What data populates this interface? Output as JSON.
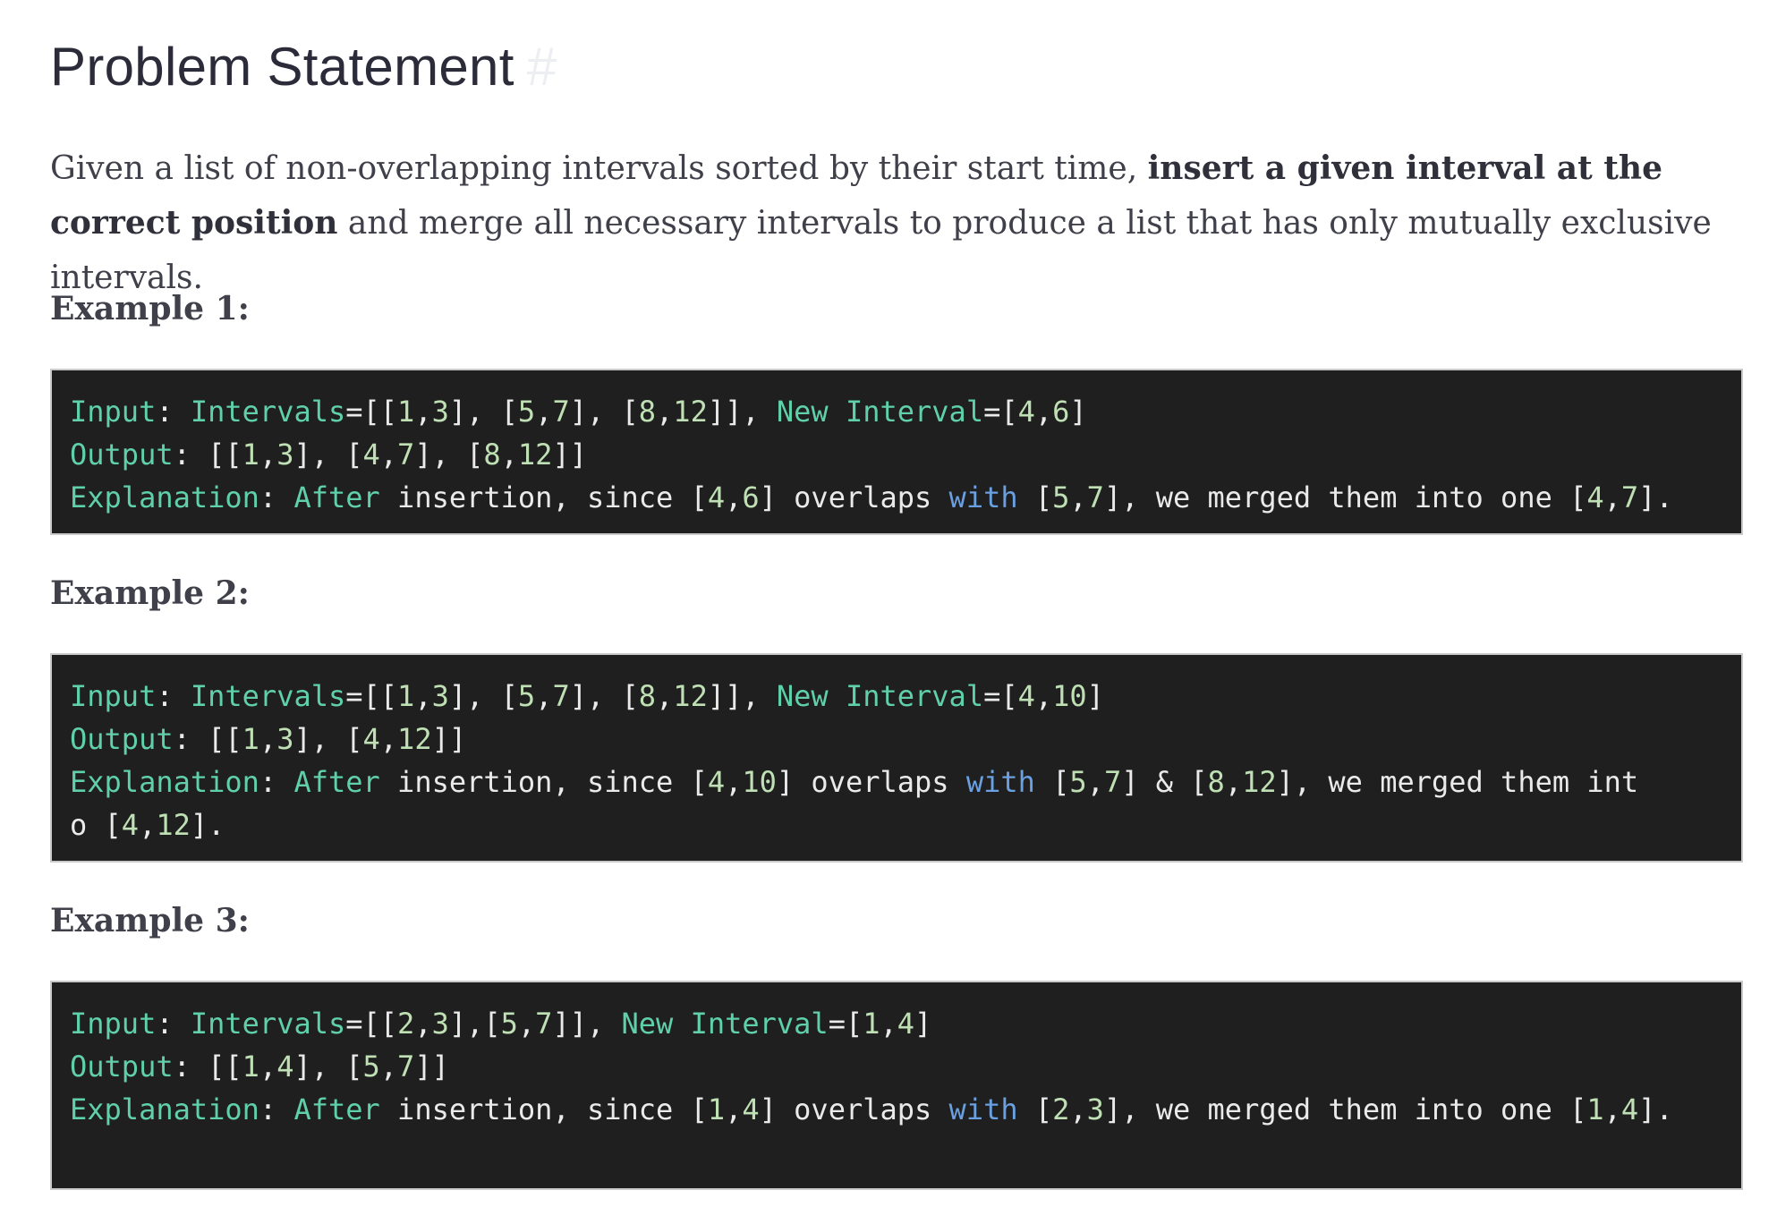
{
  "heading": {
    "title": "Problem Statement",
    "anchor": "#"
  },
  "statement": {
    "lead": "Given a list of non-overlapping intervals sorted by their start time, ",
    "bold": "insert a given interval at the correct position",
    "tail": " and merge all necessary intervals to produce a list that has only mutually exclusive intervals."
  },
  "examples": [
    {
      "heading": "Example 1:",
      "lines": [
        "Input: Intervals=[[1,3], [5,7], [8,12]], New Interval=[4,6]",
        "Output: [[1,3], [4,7], [8,12]]",
        "Explanation: After insertion, since [4,6] overlaps with [5,7], we merged them into one [4,7]."
      ]
    },
    {
      "heading": "Example 2:",
      "lines": [
        "Input: Intervals=[[1,3], [5,7], [8,12]], New Interval=[4,10]",
        "Output: [[1,3], [4,12]]",
        "Explanation: After insertion, since [4,10] overlaps with [5,7] & [8,12], we merged them int",
        "o [4,12]."
      ]
    },
    {
      "heading": "Example 3:",
      "lines": [
        "Input: Intervals=[[2,3],[5,7]], New Interval=[1,4]",
        "Output: [[1,4], [5,7]]",
        "Explanation: After insertion, since [1,4] overlaps with [2,3], we merged them into one [1,4]."
      ]
    }
  ],
  "colors": {
    "code_background": "#1f1f1f",
    "keyword": "#5fd0aa",
    "number": "#bfe0b4",
    "with_keyword": "#6a9fe0"
  }
}
